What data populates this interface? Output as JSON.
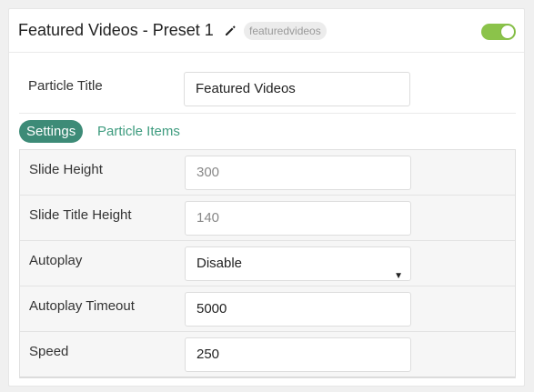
{
  "header": {
    "title": "Featured Videos - Preset 1",
    "badge": "featuredvideos",
    "enabled": true
  },
  "particle_title": {
    "label": "Particle Title",
    "value": "Featured Videos"
  },
  "tabs": [
    {
      "label": "Settings",
      "active": true
    },
    {
      "label": "Particle Items",
      "active": false
    }
  ],
  "settings": {
    "slide_height": {
      "label": "Slide Height",
      "placeholder": "300"
    },
    "slide_title_height": {
      "label": "Slide Title Height",
      "placeholder": "140"
    },
    "autoplay": {
      "label": "Autoplay",
      "value": "Disable",
      "arrow": "▼"
    },
    "autoplay_timeout": {
      "label": "Autoplay Timeout",
      "value": "5000"
    },
    "speed": {
      "label": "Speed",
      "value": "250"
    }
  },
  "colors": {
    "accent": "#3d8b77",
    "toggle_on": "#8bc34a",
    "tab_link": "#3d9b7e"
  },
  "icons": {
    "edit": "pencil-icon",
    "toggle": "toggle-switch"
  }
}
